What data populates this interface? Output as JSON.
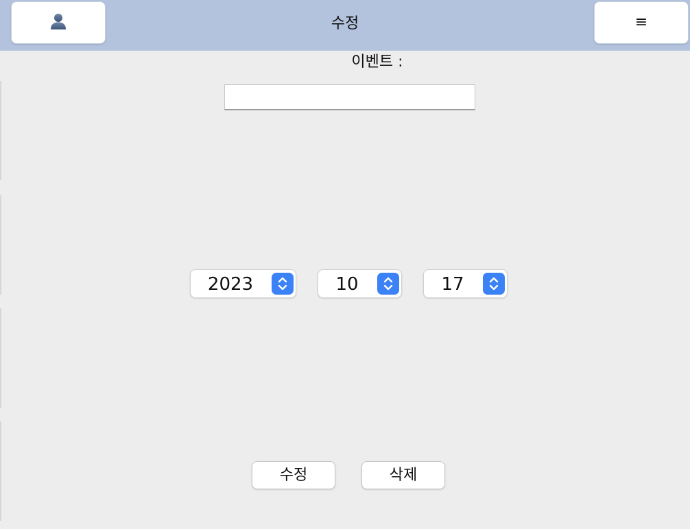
{
  "header": {
    "title": "수정",
    "user_icon": "user-icon",
    "menu_icon": "hamburger-menu-icon",
    "menu_glyph": "≡",
    "background": "#b3c3dd"
  },
  "form": {
    "event_label": "이벤트 :",
    "event_value": "",
    "year": "2023",
    "month": "10",
    "day": "17",
    "stepper_icon": "up-down-chevron-icon",
    "accent": "#3b82f6"
  },
  "actions": {
    "edit_label": "수정",
    "delete_label": "삭제"
  }
}
